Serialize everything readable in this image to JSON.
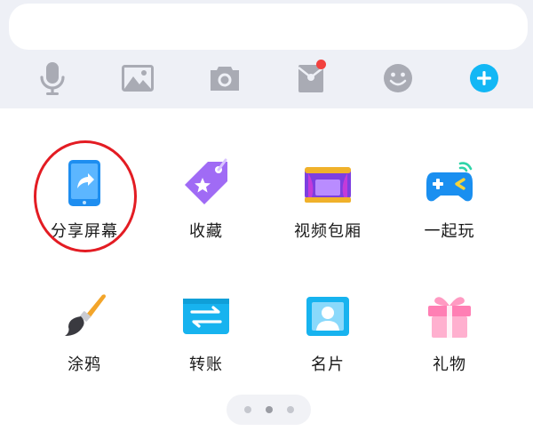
{
  "input": {
    "value": ""
  },
  "toolbar": {
    "items": [
      {
        "icon": "microphone-icon"
      },
      {
        "icon": "image-icon"
      },
      {
        "icon": "camera-icon"
      },
      {
        "icon": "red-envelope-icon",
        "has_badge": true
      },
      {
        "icon": "emoji-icon"
      },
      {
        "icon": "plus-icon"
      }
    ]
  },
  "apps": [
    {
      "label": "分享屏幕",
      "icon": "share-screen-icon"
    },
    {
      "label": "收藏",
      "icon": "favorites-icon"
    },
    {
      "label": "视频包厢",
      "icon": "video-theater-icon"
    },
    {
      "label": "一起玩",
      "icon": "gamepad-icon"
    },
    {
      "label": "涂鸦",
      "icon": "paintbrush-icon"
    },
    {
      "label": "转账",
      "icon": "transfer-icon"
    },
    {
      "label": "名片",
      "icon": "contact-card-icon"
    },
    {
      "label": "礼物",
      "icon": "gift-icon"
    }
  ],
  "pager": {
    "pages": 3,
    "current": 1
  },
  "colors": {
    "accent": "#12b7f5",
    "toolbar_icon": "#a9abb4",
    "badge": "#f2413e",
    "highlight": "#e31c23"
  }
}
